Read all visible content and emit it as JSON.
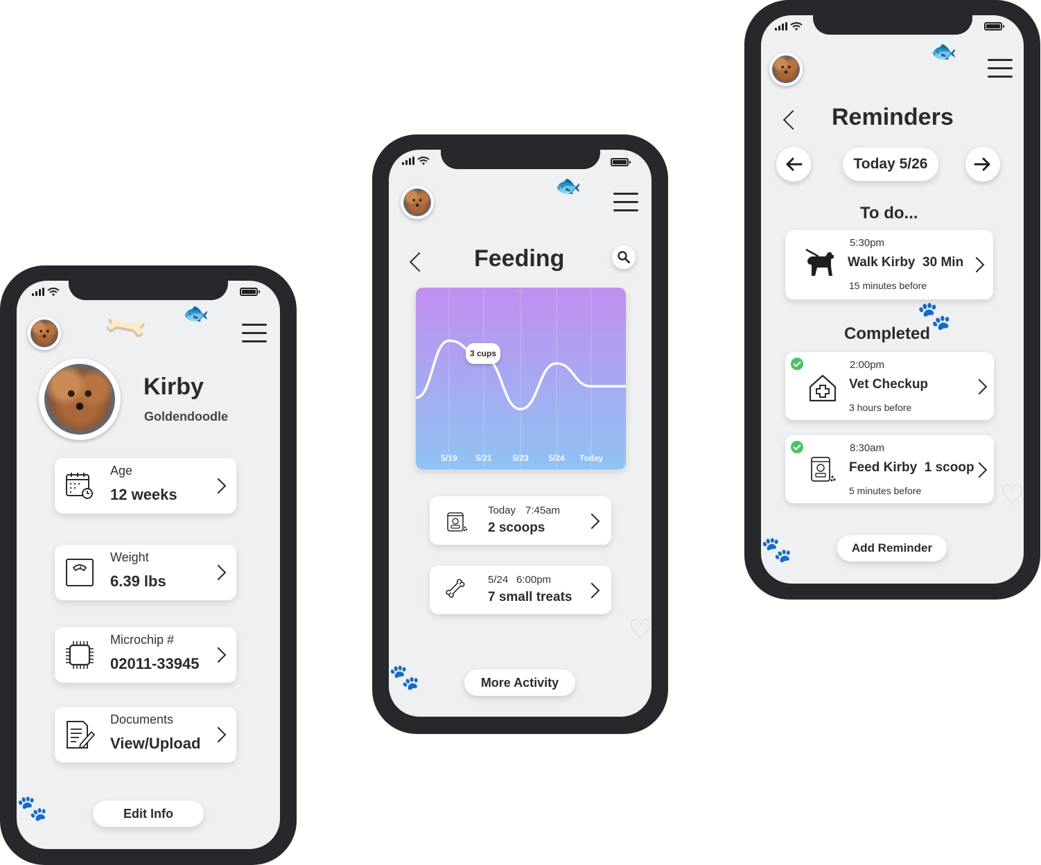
{
  "profile": {
    "name": "Kirby",
    "breed": "Goldendoodle",
    "cards": [
      {
        "label": "Age",
        "value": "12 weeks",
        "icon": "calendar-icon"
      },
      {
        "label": "Weight",
        "value": "6.39 lbs",
        "icon": "scale-icon"
      },
      {
        "label": "Microchip #",
        "value": "02011-33945",
        "icon": "chip-icon"
      },
      {
        "label": "Documents",
        "value": "View/Upload",
        "icon": "document-icon"
      }
    ],
    "edit_label": "Edit Info"
  },
  "feeding": {
    "title": "Feeding",
    "tooltip": "3 cups",
    "chart_colors": {
      "top": "#c18ef0",
      "bottom": "#8fc3f3"
    },
    "entries": [
      {
        "date": "Today",
        "time": "7:45am",
        "amount": "2 scoops",
        "icon": "food-bag-icon"
      },
      {
        "date": "5/24",
        "time": "6:00pm",
        "amount": "7 small treats",
        "icon": "bone-icon"
      }
    ],
    "more_label": "More Activity"
  },
  "chart_data": {
    "type": "line",
    "categories": [
      "5/19",
      "5/21",
      "5/23",
      "5/24",
      "Today"
    ],
    "series": [
      {
        "values": [
          3.0,
          2.4,
          0.6,
          2.2,
          1.4
        ]
      }
    ],
    "title": "",
    "xlabel": "",
    "ylabel": "",
    "grid": true,
    "annotations": [
      "3 cups"
    ]
  },
  "reminders": {
    "title": "Reminders",
    "date_label": "Today 5/26",
    "todo_heading": "To do...",
    "todo": [
      {
        "time": "5:30pm",
        "task": "Walk Kirby  30 Min",
        "note": "15 minutes before",
        "icon": "dog-walk-icon"
      }
    ],
    "completed_heading": "Completed",
    "completed": [
      {
        "time": "2:00pm",
        "task": "Vet Checkup",
        "note": "3 hours before",
        "icon": "vet-house-icon"
      },
      {
        "time": "8:30am",
        "task": "Feed Kirby  1 scoop",
        "note": "5 minutes before",
        "icon": "food-bag-icon"
      }
    ],
    "add_label": "Add Reminder"
  }
}
